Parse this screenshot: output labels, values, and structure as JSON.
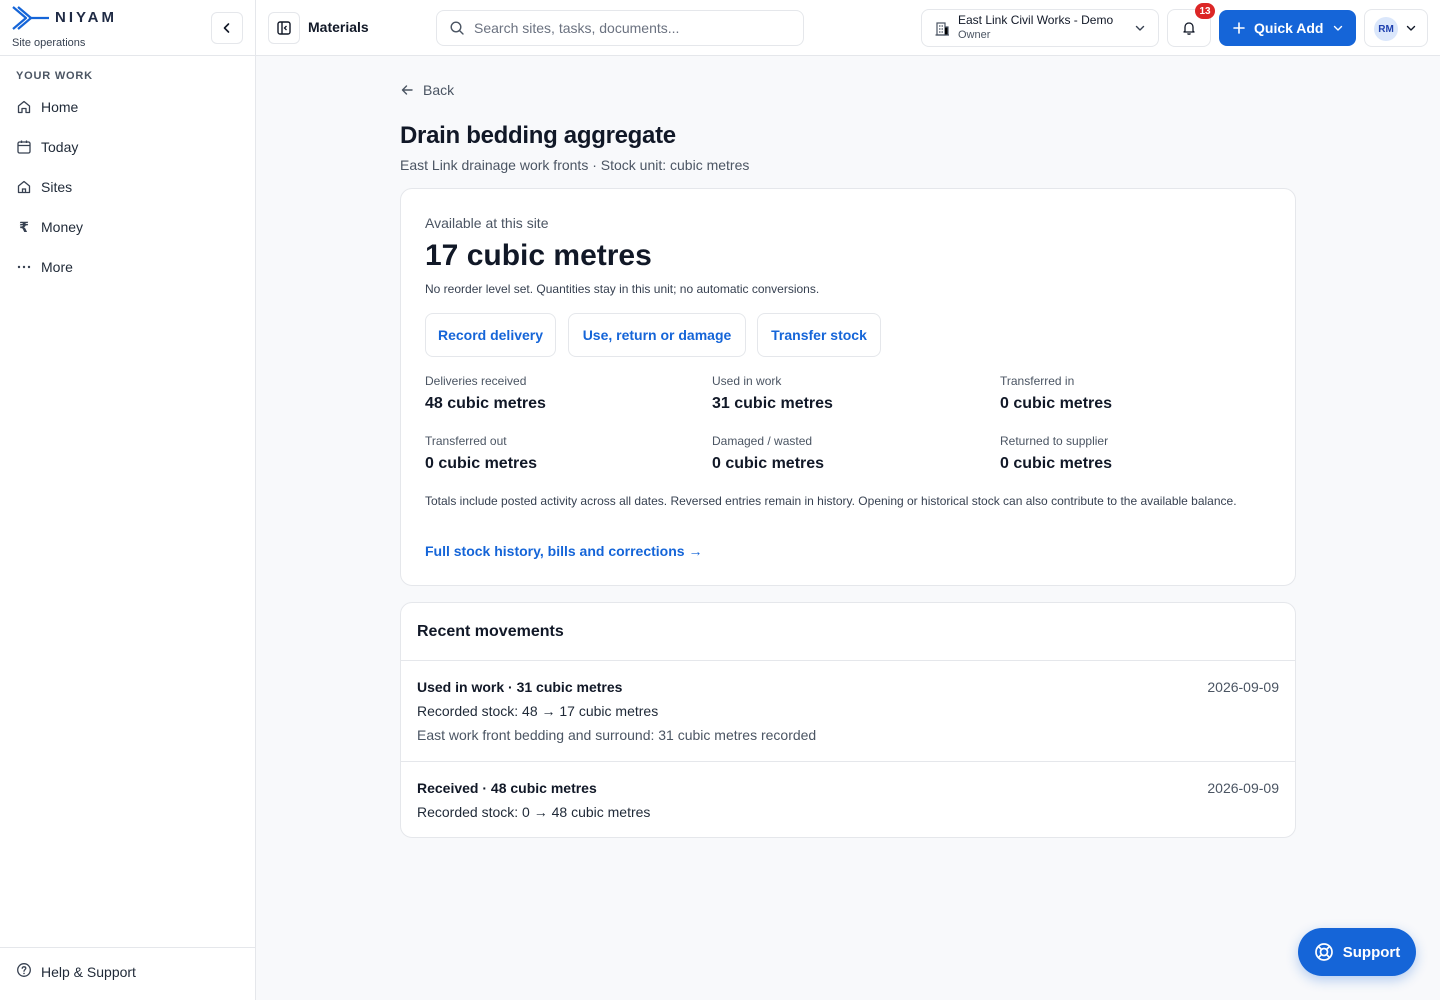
{
  "brand": {
    "name": "NIYAM",
    "subtitle": "Site operations"
  },
  "sidebar": {
    "section_label": "YOUR WORK",
    "items": [
      {
        "label": "Home",
        "icon": "home-icon"
      },
      {
        "label": "Today",
        "icon": "calendar-icon"
      },
      {
        "label": "Sites",
        "icon": "building-icon"
      },
      {
        "label": "Money",
        "icon": "rupee-icon"
      },
      {
        "label": "More",
        "icon": "more-icon"
      }
    ],
    "footer": {
      "label": "Help & Support",
      "icon": "help-icon"
    }
  },
  "topbar": {
    "page": "Materials",
    "search_placeholder": "Search sites, tasks, documents...",
    "org_name": "East Link Civil Works - Demo",
    "org_role": "Owner",
    "notification_count": "13",
    "quick_add_label": "Quick Add",
    "user_initials": "RM"
  },
  "main": {
    "back_label": "Back",
    "title": "Drain bedding aggregate",
    "subtitle": "East Link drainage work fronts · Stock unit: cubic metres",
    "available_label": "Available at this site",
    "available_value": "17 cubic metres",
    "available_note": "No reorder level set. Quantities stay in this unit; no automatic conversions.",
    "actions": {
      "record_delivery": "Record delivery",
      "use_return_damage": "Use, return or damage",
      "transfer_stock": "Transfer stock"
    },
    "stats": [
      {
        "label": "Deliveries received",
        "value": "48 cubic metres"
      },
      {
        "label": "Used in work",
        "value": "31 cubic metres"
      },
      {
        "label": "Transferred in",
        "value": "0 cubic metres"
      },
      {
        "label": "Transferred out",
        "value": "0 cubic metres"
      },
      {
        "label": "Damaged / wasted",
        "value": "0 cubic metres"
      },
      {
        "label": "Returned to supplier",
        "value": "0 cubic metres"
      }
    ],
    "totals_note": "Totals include posted activity across all dates. Reversed entries remain in history. Opening or historical stock can also contribute to the available balance.",
    "history_link": "Full stock history, bills and corrections →"
  },
  "movements": {
    "title": "Recent movements",
    "items": [
      {
        "heading": "Used in work · 31 cubic metres",
        "date": "2026-09-09",
        "line": "Recorded stock: 48 → 17 cubic metres",
        "note": "East work front bedding and surround: 31 cubic metres recorded"
      },
      {
        "heading": "Received · 48 cubic metres",
        "date": "2026-09-09",
        "line": "Recorded stock: 0 → 48 cubic metres",
        "note": ""
      }
    ]
  },
  "support_label": "Support",
  "colors": {
    "accent": "#1565d8",
    "badge": "#dc2626",
    "brand": "#1f2a44"
  }
}
